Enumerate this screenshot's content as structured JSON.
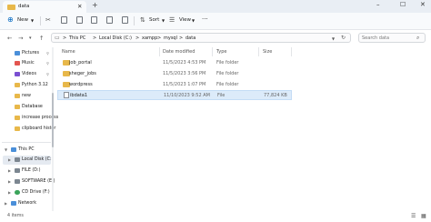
{
  "tab": {
    "title": "data",
    "close": "✕"
  },
  "window": {
    "new_tab": "+",
    "minimize": "–",
    "maximize": "☐",
    "close": "✕"
  },
  "toolbar": {
    "new_label": "New",
    "sort_label": "Sort",
    "view_label": "View",
    "more": "···"
  },
  "address": {
    "breadcrumbs": [
      "This PC",
      "Local Disk (C:)",
      "xampp",
      "mysql",
      "data"
    ],
    "separator": ">",
    "search_placeholder": "Search data"
  },
  "sidebar": {
    "quick_access": [
      {
        "label": "Pictures",
        "icon": "pictures-icon",
        "color": "#4a8fd9"
      },
      {
        "label": "Music",
        "icon": "music-icon",
        "color": "#e3554f"
      },
      {
        "label": "Videos",
        "icon": "videos-icon",
        "color": "#7a4fd1"
      },
      {
        "label": "Python 3.12",
        "icon": "folder-icon",
        "color": "#e8b84a"
      },
      {
        "label": "new",
        "icon": "folder-icon",
        "color": "#e8b84a"
      },
      {
        "label": "Database",
        "icon": "folder-icon",
        "color": "#e8b84a"
      },
      {
        "label": "increase process",
        "icon": "folder-icon",
        "color": "#e8b84a"
      },
      {
        "label": "clipboard histor",
        "icon": "folder-icon",
        "color": "#e8b84a"
      }
    ],
    "tree": [
      {
        "label": "This PC",
        "icon": "pc-icon",
        "color": "#4a8fd9"
      },
      {
        "label": "Local Disk (C:)",
        "icon": "drive-icon",
        "color": "#7c8690"
      },
      {
        "label": "FILE (D:)",
        "icon": "drive-icon",
        "color": "#7c8690"
      },
      {
        "label": "SOFTWARE (E:)",
        "icon": "drive-icon",
        "color": "#7c8690"
      },
      {
        "label": "CD Drive (F:)",
        "icon": "cd-drive-icon",
        "color": "#3aa45a"
      },
      {
        "label": "Network",
        "icon": "network-icon",
        "color": "#4a8fd9"
      }
    ]
  },
  "columns": [
    "Name",
    "Date modified",
    "Type",
    "Size"
  ],
  "rows": [
    {
      "name": "job_portal",
      "date": "11/5/2023 4:53 PM",
      "type": "File folder",
      "size": "",
      "kind": "folder"
    },
    {
      "name": "sheger_jobs",
      "date": "11/5/2023 3:56 PM",
      "type": "File folder",
      "size": "",
      "kind": "folder"
    },
    {
      "name": "wordpress",
      "date": "11/5/2023 1:07 PM",
      "type": "File folder",
      "size": "",
      "kind": "folder"
    },
    {
      "name": "ibdata1",
      "date": "11/10/2023 9:52 AM",
      "type": "File",
      "size": "77,824 KB",
      "kind": "file"
    }
  ],
  "status": {
    "item_count": "4 items"
  },
  "colors": {
    "accent": "#0067c0",
    "selected_row": "#dcebfa",
    "selected_side": "#e5eaf1"
  }
}
